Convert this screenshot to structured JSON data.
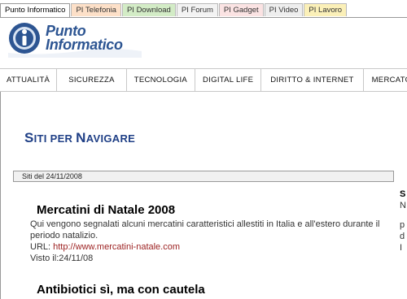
{
  "tabs": [
    "Punto Informatico",
    "PI Telefonia",
    "PI Download",
    "PI Forum",
    "PI Gadget",
    "PI Video",
    "PI Lavoro"
  ],
  "logo": {
    "line1": "Punto",
    "line2": "Informatico"
  },
  "nav": [
    "ATTUALITÀ",
    "SICUREZZA",
    "TECNOLOGIA",
    "DIGITAL LIFE",
    "DIRITTO & INTERNET",
    "MERCATO"
  ],
  "section": {
    "title_big1": "S",
    "title_small1": "ITI PER ",
    "title_big2": "N",
    "title_small2": "AVIGARE"
  },
  "date_bar": "Siti del 24/11/2008",
  "articles": [
    {
      "title": "Mercatini di Natale 2008",
      "desc": "Qui vengono segnalati alcuni mercatini caratteristici allestiti in Italia e all'estero durante il periodo natalizio.",
      "url_label": "URL: ",
      "url": "http://www.mercatini-natale.com",
      "visit": "Visto il:24/11/08"
    },
    {
      "title": "Antibiotici sì, ma con cautela"
    }
  ],
  "side": {
    "l1": "S",
    "l2": "N",
    "l3": "p",
    "l4": "d",
    "l5": "I"
  },
  "colors": {
    "accent": "#1f3f86",
    "link": "#9b1f1f"
  }
}
